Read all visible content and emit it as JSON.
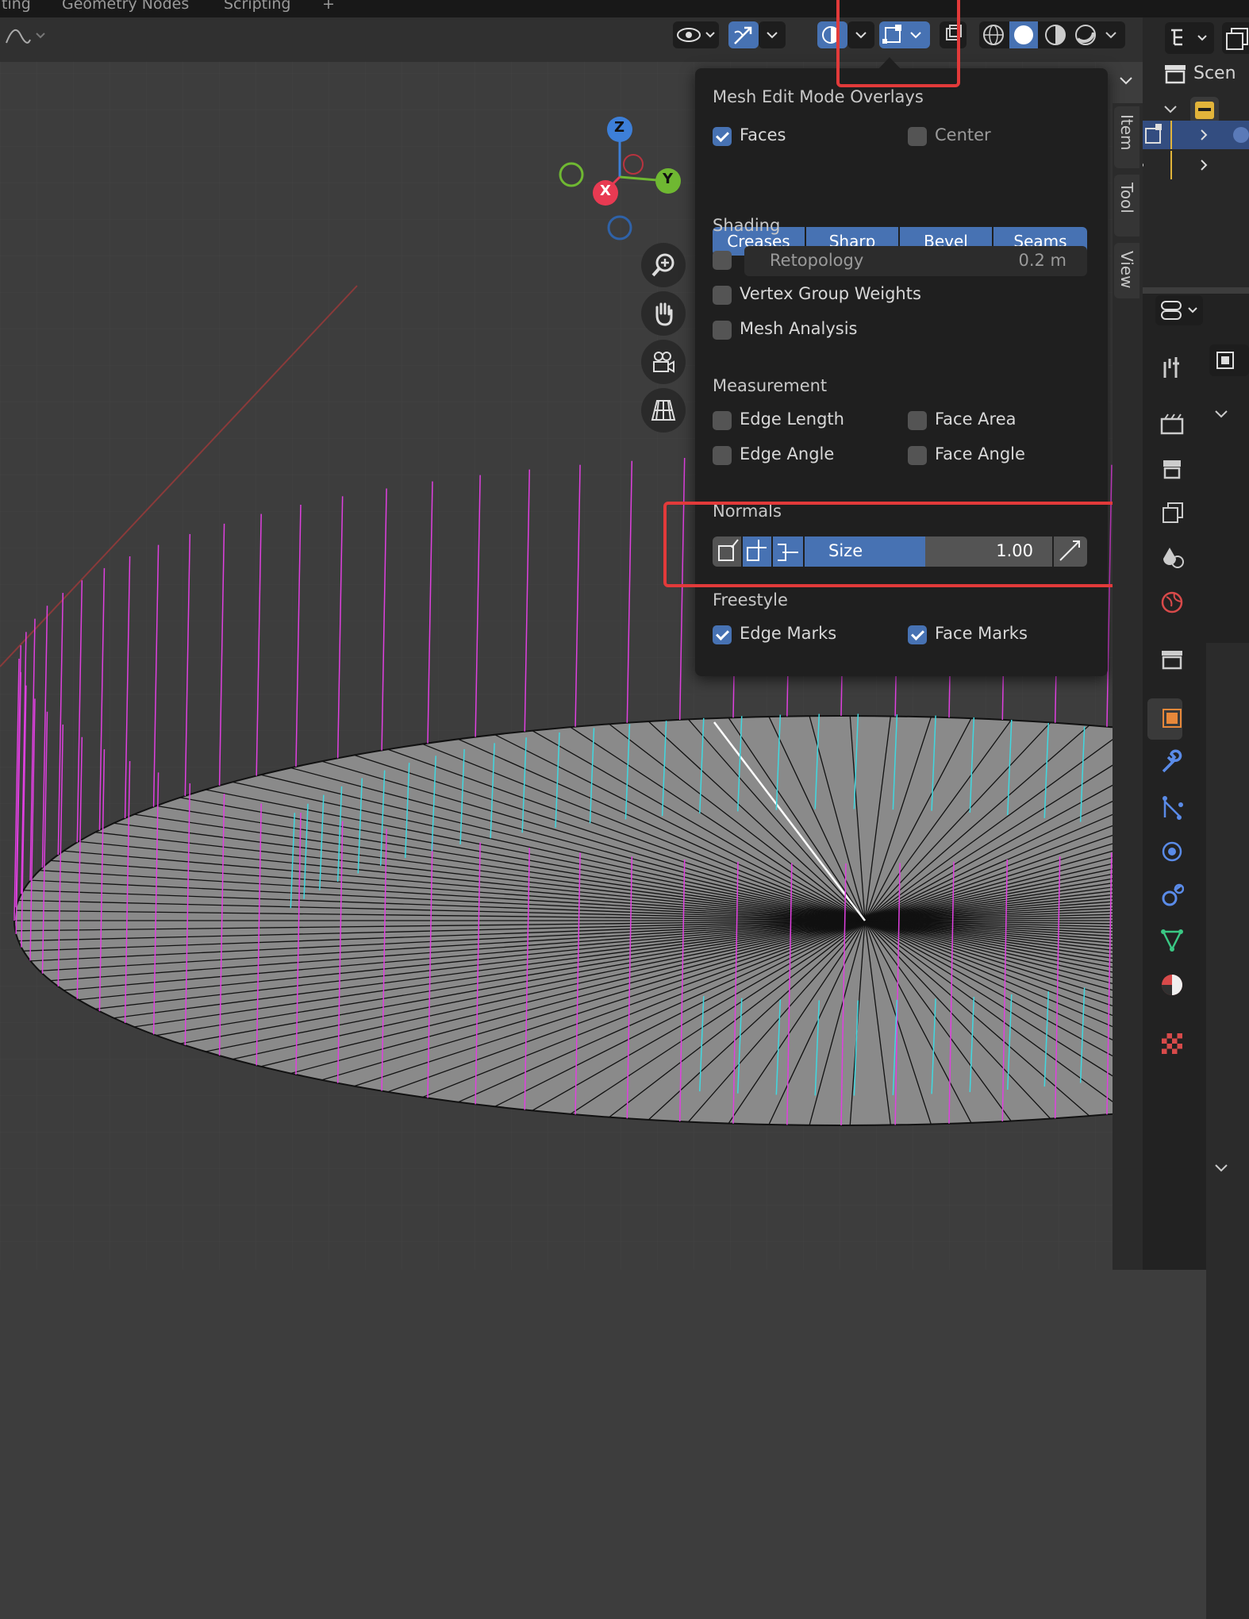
{
  "workspace_tabs": [
    "ting",
    "Geometry Nodes",
    "Scripting",
    "+"
  ],
  "outliner": {
    "scene_label": "Scen"
  },
  "popover": {
    "title": "Mesh Edit Mode Overlays",
    "faces_label": "Faces",
    "faces_checked": true,
    "center_label": "Center",
    "center_checked": false,
    "segments": [
      "Creases",
      "Sharp",
      "Bevel",
      "Seams"
    ],
    "shading": {
      "title": "Shading",
      "retopology_label": "Retopology",
      "retopology_value": "0.2 m",
      "vertex_group_weights": "Vertex Group Weights",
      "mesh_analysis": "Mesh Analysis"
    },
    "measurement": {
      "title": "Measurement",
      "edge_length": "Edge Length",
      "face_area": "Face Area",
      "edge_angle": "Edge Angle",
      "face_angle": "Face Angle"
    },
    "normals": {
      "title": "Normals",
      "size_label": "Size",
      "size_value": "1.00"
    },
    "freestyle": {
      "title": "Freestyle",
      "edge_marks": "Edge Marks",
      "edge_marks_checked": true,
      "face_marks": "Face Marks",
      "face_marks_checked": true
    }
  },
  "gizmo": {
    "z": "Z",
    "y": "Y",
    "x": "X"
  },
  "npanel_tabs": [
    "Item",
    "Tool",
    "View"
  ],
  "colors": {
    "accent": "#4772b3",
    "highlight": "#e23a3a",
    "normal_vertex": "#e040e0",
    "normal_face": "#40d8e0"
  }
}
